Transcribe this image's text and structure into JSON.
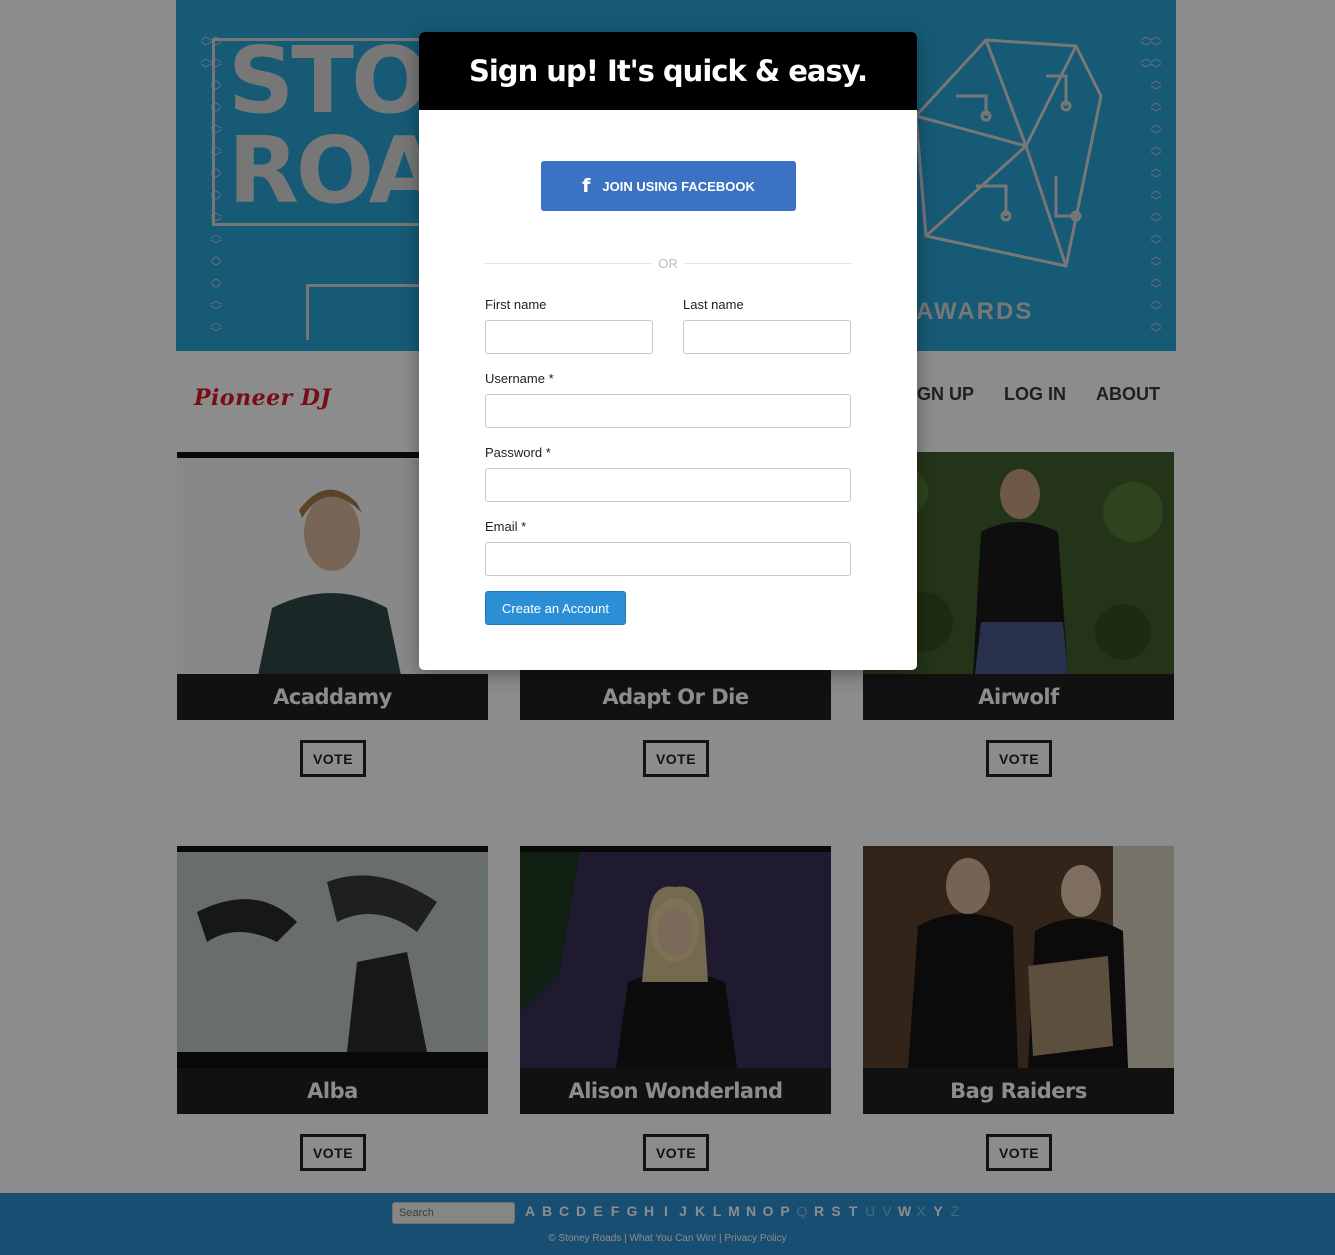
{
  "banner": {
    "logo_line1": "STONEY",
    "logo_line2": "ROADS",
    "awards_text": "AWARDS",
    "colors": {
      "background": "#2ba4d8",
      "artwork": "#d9d9d9"
    }
  },
  "nav": {
    "sponsor_logo_text": "Pioneer DJ",
    "links": [
      "SIGN UP",
      "LOG IN",
      "ABOUT"
    ]
  },
  "artists": [
    {
      "name": "Acaddamy",
      "vote_label": "VOTE"
    },
    {
      "name": "Adapt Or Die",
      "vote_label": "VOTE"
    },
    {
      "name": "Airwolf",
      "vote_label": "VOTE"
    },
    {
      "name": "Alba",
      "vote_label": "VOTE"
    },
    {
      "name": "Alison Wonderland",
      "vote_label": "VOTE"
    },
    {
      "name": "Bag Raiders",
      "vote_label": "VOTE"
    }
  ],
  "footer": {
    "search_placeholder": "Search",
    "letters": [
      {
        "l": "A",
        "active": true
      },
      {
        "l": "B",
        "active": true
      },
      {
        "l": "C",
        "active": true
      },
      {
        "l": "D",
        "active": true
      },
      {
        "l": "E",
        "active": true
      },
      {
        "l": "F",
        "active": true
      },
      {
        "l": "G",
        "active": true
      },
      {
        "l": "H",
        "active": true
      },
      {
        "l": "I",
        "active": true
      },
      {
        "l": "J",
        "active": true
      },
      {
        "l": "K",
        "active": true
      },
      {
        "l": "L",
        "active": true
      },
      {
        "l": "M",
        "active": true
      },
      {
        "l": "N",
        "active": true
      },
      {
        "l": "O",
        "active": true
      },
      {
        "l": "P",
        "active": true
      },
      {
        "l": "Q",
        "active": false
      },
      {
        "l": "R",
        "active": true
      },
      {
        "l": "S",
        "active": true
      },
      {
        "l": "T",
        "active": true
      },
      {
        "l": "U",
        "active": false
      },
      {
        "l": "V",
        "active": false
      },
      {
        "l": "W",
        "active": true
      },
      {
        "l": "X",
        "active": false
      },
      {
        "l": "Y",
        "active": true
      },
      {
        "l": "Z",
        "active": false
      }
    ],
    "copyright": "© Stoney Roads | What You Can Win! | Privacy Policy"
  },
  "modal": {
    "title": "Sign up! It's quick & easy.",
    "facebook_icon": "facebook-f-icon",
    "facebook_label": "JOIN USING FACEBOOK",
    "divider_text": "OR",
    "first_name_label": "First name",
    "first_name_value": "",
    "last_name_label": "Last name",
    "last_name_value": "",
    "username_label": "Username *",
    "username_value": "",
    "password_label": "Password *",
    "password_value": "",
    "email_label": "Email *",
    "email_value": "",
    "submit_label": "Create an Account",
    "colors": {
      "facebook": "#3b72c4",
      "submit": "#2b8fd6",
      "header": "#000000"
    }
  }
}
